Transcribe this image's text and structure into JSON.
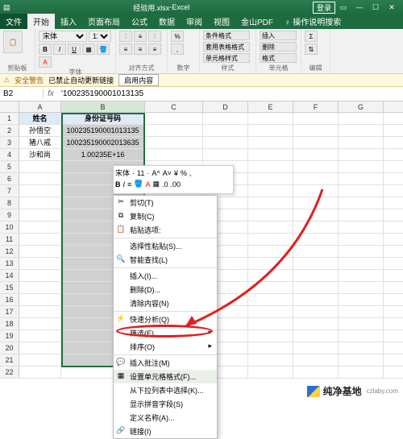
{
  "title": {
    "filename": "经验用.xlsx",
    "app": "Excel",
    "login": "登录"
  },
  "tabs": {
    "file": "文件",
    "items": [
      "开始",
      "插入",
      "页面布局",
      "公式",
      "数据",
      "审阅",
      "视图",
      "金山PDF",
      "操作说明搜索"
    ],
    "active": 0
  },
  "ribbon": {
    "clipboard": {
      "label": "剪贴板",
      "paste": "粘贴"
    },
    "font": {
      "label": "字体",
      "bold": "B",
      "italic": "I",
      "underline": "U"
    },
    "align": {
      "label": "对齐方式"
    },
    "number": {
      "label": "数字"
    },
    "styles": {
      "label": "样式",
      "condfmt": "条件格式",
      "tablefmt": "套用表格格式",
      "cellstyle": "单元格样式"
    },
    "cells": {
      "label": "单元格",
      "insert": "插入",
      "delete": "删除",
      "format": "格式"
    },
    "editing": {
      "label": "编辑"
    }
  },
  "warn": {
    "tag": "安全警告",
    "msg": "已禁止自动更新链接",
    "btn": "启用内容"
  },
  "fxbar": {
    "name": "B2",
    "formula": "'100235190001013135"
  },
  "cols": [
    "A",
    "B",
    "C",
    "D",
    "E",
    "F",
    "G"
  ],
  "data": {
    "A1": "姓名",
    "B1": "身份证号码",
    "A2": "孙悟空",
    "B2": "100235190001013135",
    "A3": "猪八戒",
    "B3": "100235190002013635",
    "A4": "沙和尚",
    "B4": "1.00235E+16"
  },
  "minitb": {
    "font": "宋体",
    "size": "11"
  },
  "context": {
    "items": [
      {
        "t": "剪切(T)",
        "i": "✂"
      },
      {
        "t": "复制(C)",
        "i": "⧉"
      },
      {
        "t": "粘贴选项:",
        "i": "📋"
      },
      {
        "sep": true
      },
      {
        "t": "选择性粘贴(S)..."
      },
      {
        "t": "智能查找(L)",
        "i": "🔍"
      },
      {
        "sep": true
      },
      {
        "t": "插入(I)..."
      },
      {
        "t": "删除(D)..."
      },
      {
        "t": "清除内容(N)"
      },
      {
        "sep": true
      },
      {
        "t": "快速分析(Q)",
        "i": "⚡"
      },
      {
        "t": "筛选(E)",
        "sub": true
      },
      {
        "t": "排序(O)",
        "sub": true
      },
      {
        "sep": true
      },
      {
        "t": "插入批注(M)",
        "i": "💬"
      },
      {
        "t": "设置单元格格式(F)...",
        "hl": true,
        "i": "▦"
      },
      {
        "t": "从下拉列表中选择(K)..."
      },
      {
        "t": "显示拼音字段(S)"
      },
      {
        "t": "定义名称(A)..."
      },
      {
        "t": "链接(I)",
        "i": "🔗"
      }
    ]
  },
  "watermark": {
    "name": "纯净基地",
    "url": "czlaby.com"
  }
}
